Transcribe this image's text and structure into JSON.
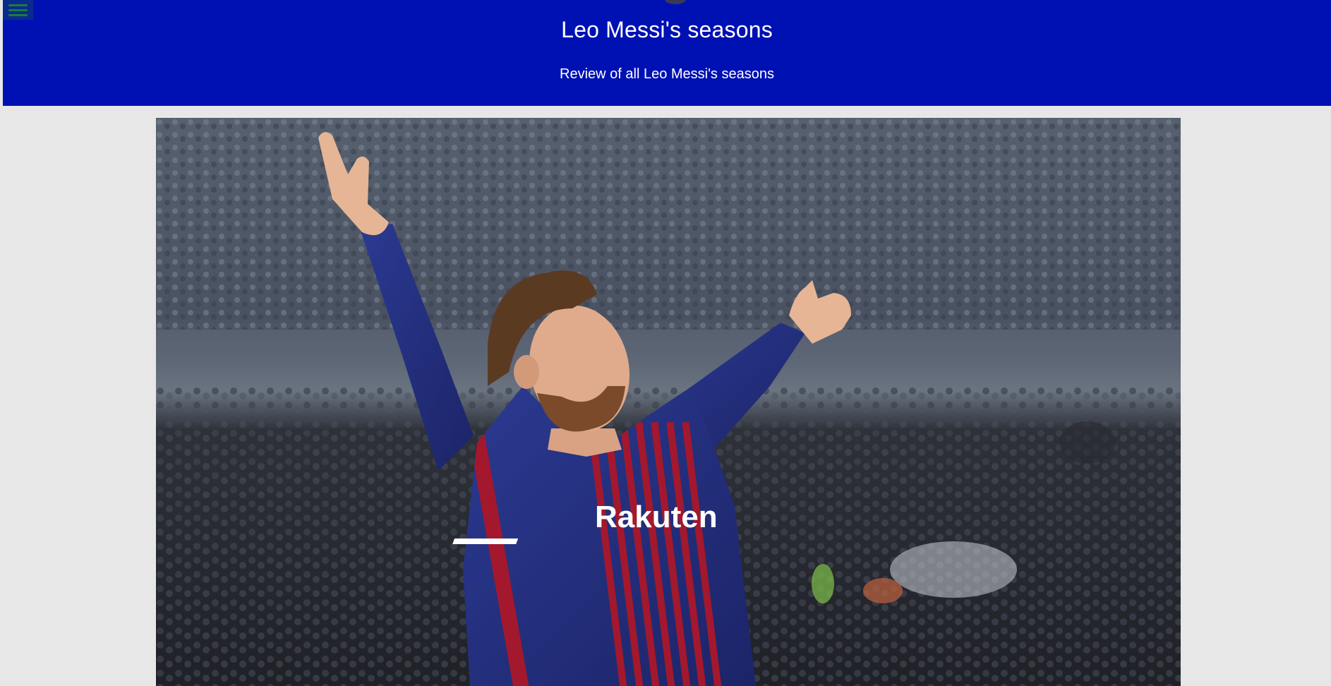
{
  "header": {
    "title": "Leo Messi's seasons",
    "subtitle": "Review of all Leo Messi's seasons",
    "background_color": "#0011b4",
    "menu_icon": "hamburger-menu-icon"
  },
  "hero": {
    "jersey_sponsor": "Rakuten"
  },
  "colors": {
    "page_background": "#e7e7e7",
    "jersey_blue": "#24307f",
    "jersey_red": "#a3182d"
  }
}
